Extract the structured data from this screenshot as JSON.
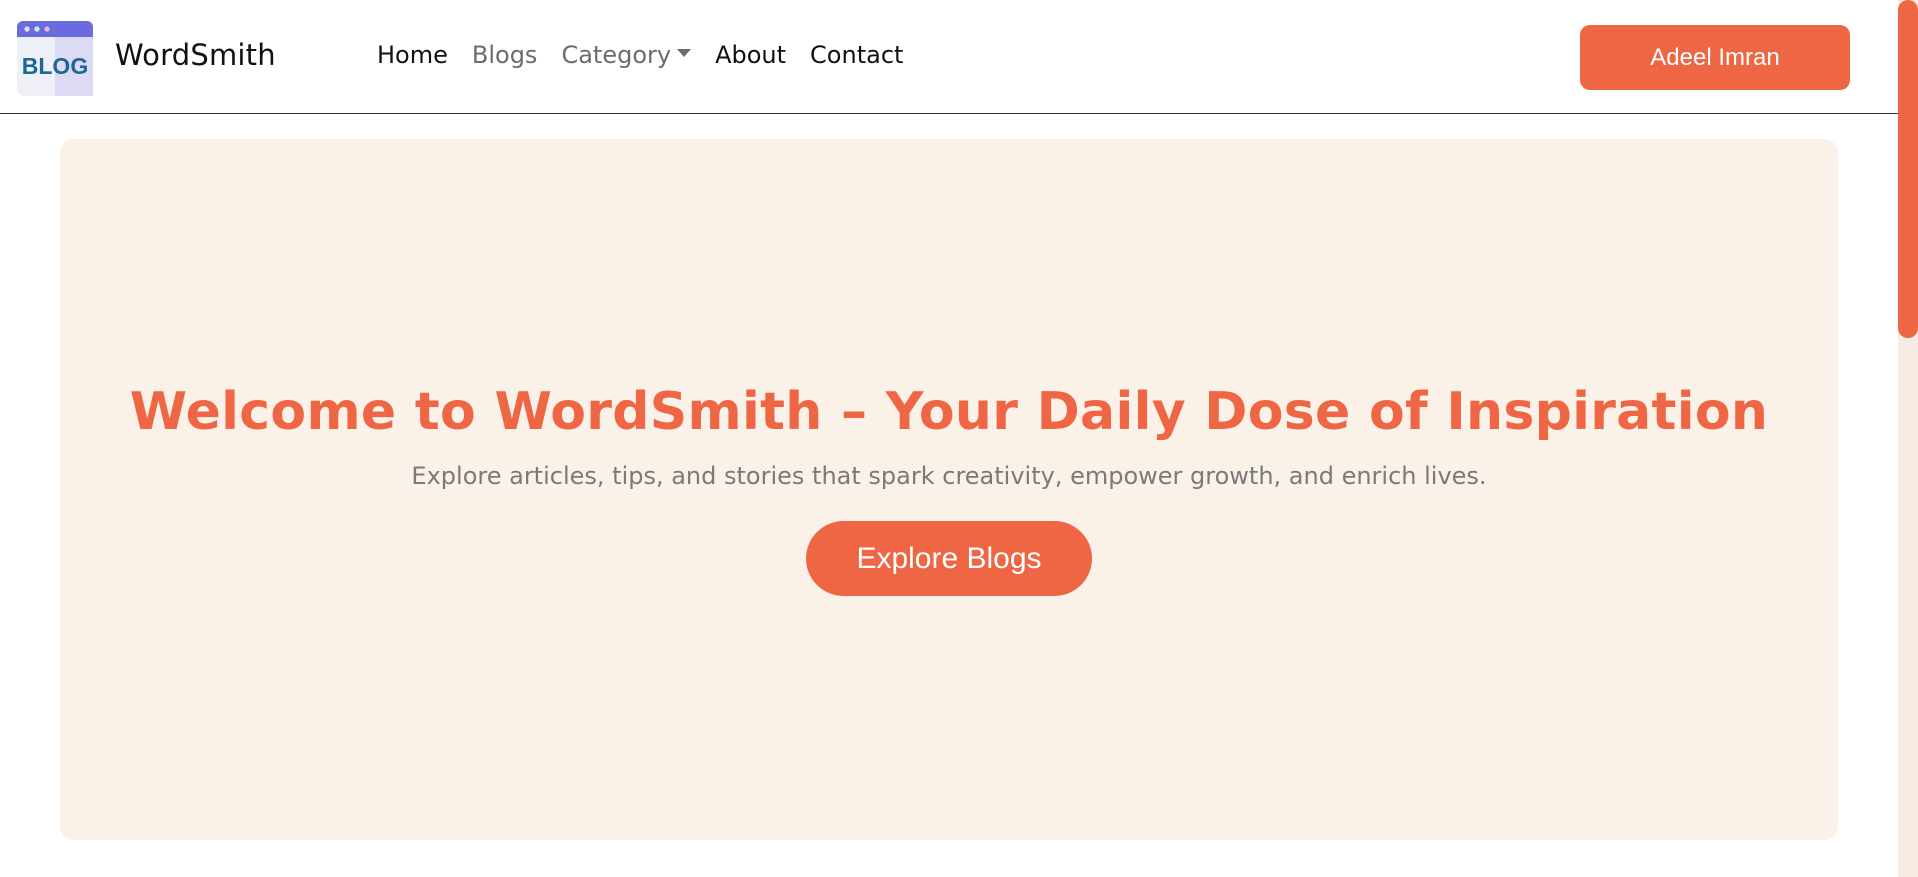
{
  "brand": {
    "logo_text": "BLOG",
    "name": "WordSmith"
  },
  "nav": {
    "items": [
      {
        "label": "Home"
      },
      {
        "label": "Blogs"
      },
      {
        "label": "Category"
      },
      {
        "label": "About"
      },
      {
        "label": "Contact"
      }
    ]
  },
  "user": {
    "button_label": "Adeel Imran"
  },
  "hero": {
    "title": "Welcome to WordSmith – Your Daily Dose of Inspiration",
    "subtitle": "Explore articles, tips, and stories that spark creativity, empower growth, and enrich lives.",
    "cta_label": "Explore Blogs"
  },
  "colors": {
    "accent": "#ee6644",
    "hero_bg": "#faf1e8",
    "logo_bar": "#6b6be0"
  },
  "icons": {
    "logo": "blog-logo-icon",
    "dropdown": "chevron-down-icon"
  }
}
